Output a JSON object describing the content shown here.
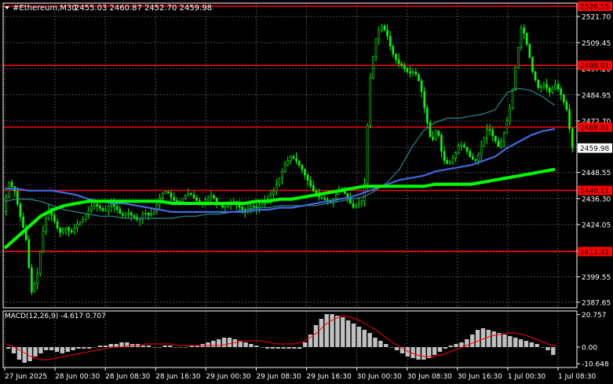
{
  "header": {
    "symbol_label": "#Ethereum,M30",
    "ohlc": "2455.03 2460.87 2452.70 2459.98"
  },
  "colors": {
    "background": "#000000",
    "grid": "#4a4a4a",
    "frame": "#ffffff",
    "candle": "#00ff00",
    "ma_fast": "#2a8a8a",
    "ma_medium": "#4169e1",
    "ma_slow": "#00ff00",
    "level_line": "#ff0000",
    "level_label_bg": "#ff0000",
    "price_tag_bg": "#ffffff",
    "macd_hist": "#c0c0c0",
    "macd_signal": "#ff0000",
    "text": "#ffffff"
  },
  "macd": {
    "label": "MACD(12,26,9) -4.617 0.707",
    "ticks": [
      "20.757",
      "0.00",
      "-10.648"
    ]
  },
  "chart_data": [
    {
      "type": "candlestick",
      "timeframe": "M30",
      "price_axis": {
        "ticks": [
          2521.7,
          2509.45,
          2497.2,
          2484.95,
          2472.7,
          2460.45,
          2448.55,
          2436.3,
          2424.05,
          2411.8,
          2399.55,
          2387.65
        ],
        "tick_labels": [
          "2521.70",
          "2509.45",
          "2497.20",
          "2484.95",
          "2472.70",
          "2460.45",
          "2448.55",
          "2436.30",
          "2424.05",
          "2411.80",
          "2399.55",
          "2387.65"
        ],
        "range": [
          2385,
          2528
        ]
      },
      "time_axis": [
        "27 Jun 2025",
        "28 Jun 00:30",
        "28 Jun 08:30",
        "28 Jun 16:30",
        "29 Jun 00:30",
        "29 Jun 08:30",
        "29 Jun 16:30",
        "30 Jun 00:30",
        "30 Jun 08:30",
        "30 Jun 16:30",
        "1 Jul 00:30",
        "1 Jul 08:30"
      ],
      "current_price": {
        "value": 2459.98,
        "label": "2459.98"
      },
      "levels": [
        {
          "value": 2526.55,
          "label": "2526.55"
        },
        {
          "value": 2498.81,
          "label": "2498.81"
        },
        {
          "value": 2469.81,
          "label": "2469.81"
        },
        {
          "value": 2440.11,
          "label": "2440.11"
        },
        {
          "value": 2411.41,
          "label": "2411.41"
        }
      ],
      "price_path": [
        2430,
        2444,
        2440,
        2428,
        2418,
        2392,
        2400,
        2420,
        2432,
        2426,
        2420,
        2423,
        2420,
        2424,
        2426,
        2430,
        2434,
        2432,
        2430,
        2434,
        2432,
        2428,
        2430,
        2428,
        2426,
        2430,
        2428,
        2432,
        2438,
        2440,
        2436,
        2434,
        2437,
        2439,
        2436,
        2434,
        2436,
        2438,
        2434,
        2432,
        2434,
        2435,
        2432,
        2430,
        2433,
        2432,
        2434,
        2436,
        2440,
        2446,
        2452,
        2456,
        2454,
        2450,
        2445,
        2440,
        2437,
        2436,
        2434,
        2438,
        2441,
        2437,
        2432,
        2434,
        2436,
        2490,
        2510,
        2518,
        2514,
        2505,
        2500,
        2498,
        2495,
        2496,
        2490,
        2475,
        2462,
        2470,
        2455,
        2452,
        2456,
        2462,
        2460,
        2455,
        2454,
        2462,
        2470,
        2465,
        2460,
        2468,
        2480,
        2500,
        2518,
        2508,
        2495,
        2488,
        2490,
        2486,
        2490,
        2485,
        2478,
        2460
      ],
      "ma_fast_path": [
        2435,
        2436,
        2436,
        2435,
        2433,
        2431,
        2430,
        2429,
        2428,
        2428,
        2427,
        2427,
        2427,
        2427,
        2427,
        2428,
        2428,
        2429,
        2429,
        2430,
        2431,
        2432,
        2432,
        2433,
        2433,
        2433,
        2433,
        2434,
        2435,
        2436,
        2437,
        2440,
        2444,
        2450,
        2460,
        2468,
        2472,
        2474,
        2474,
        2475,
        2476,
        2478,
        2486,
        2488,
        2487,
        2484,
        2480
      ],
      "ma_medium_path": [
        2441,
        2441,
        2440,
        2440,
        2440,
        2439,
        2438,
        2436,
        2435,
        2434,
        2434,
        2433,
        2432,
        2431,
        2430,
        2430,
        2430,
        2430,
        2430,
        2430,
        2430,
        2431,
        2431,
        2432,
        2432,
        2433,
        2434,
        2435,
        2436,
        2437,
        2439,
        2441,
        2443,
        2445,
        2446,
        2447,
        2449,
        2450,
        2451,
        2452,
        2454,
        2456,
        2460,
        2463,
        2466,
        2468,
        2469
      ],
      "ma_slow_path": [
        2413,
        2418,
        2423,
        2428,
        2431,
        2433,
        2434,
        2435,
        2435,
        2435,
        2435,
        2435,
        2435,
        2435,
        2434,
        2434,
        2434,
        2434,
        2434,
        2434,
        2434,
        2435,
        2435,
        2436,
        2436,
        2437,
        2438,
        2439,
        2440,
        2441,
        2442,
        2442,
        2442,
        2442,
        2442,
        2442,
        2443,
        2443,
        2443,
        2443,
        2444,
        2445,
        2446,
        2447,
        2448,
        2449,
        2450
      ],
      "macd_hist": [
        -1,
        -4,
        -8,
        -10,
        -9,
        -6,
        -4,
        -2,
        -2,
        -3,
        -4,
        -3,
        -2,
        -1,
        -1,
        -1,
        0,
        1,
        1,
        2,
        2,
        3,
        3,
        2,
        2,
        1,
        1,
        0,
        0,
        1,
        1,
        0,
        0,
        0,
        1,
        1,
        2,
        3,
        4,
        5,
        6,
        6,
        5,
        4,
        3,
        2,
        1,
        0,
        -1,
        -1,
        -1,
        -1,
        -1,
        -1,
        -1,
        3,
        8,
        14,
        18,
        21,
        21,
        20,
        19,
        17,
        15,
        13,
        11,
        9,
        6,
        4,
        2,
        0,
        -2,
        -4,
        -6,
        -7,
        -8,
        -8,
        -7,
        -5,
        -3,
        -1,
        1,
        2,
        3,
        5,
        8,
        11,
        12,
        11,
        10,
        9,
        8,
        7,
        6,
        5,
        4,
        3,
        2,
        0,
        -2,
        -5
      ],
      "macd_signal": [
        2,
        0,
        -3,
        -6,
        -8,
        -8,
        -7,
        -6,
        -5,
        -4,
        -3,
        -2,
        -1,
        0,
        0,
        1,
        1,
        2,
        2,
        2,
        2,
        1,
        1,
        1,
        1,
        1,
        1,
        2,
        3,
        4,
        4,
        4,
        3,
        2,
        2,
        2,
        3,
        6,
        10,
        15,
        18,
        20,
        19,
        17,
        14,
        11,
        7,
        3,
        0,
        -3,
        -5,
        -6,
        -6,
        -5,
        -3,
        -1,
        1,
        3,
        5,
        7,
        8,
        9,
        9,
        8,
        6,
        4,
        2,
        0.7
      ],
      "macd_range": [
        -13,
        23
      ]
    }
  ]
}
